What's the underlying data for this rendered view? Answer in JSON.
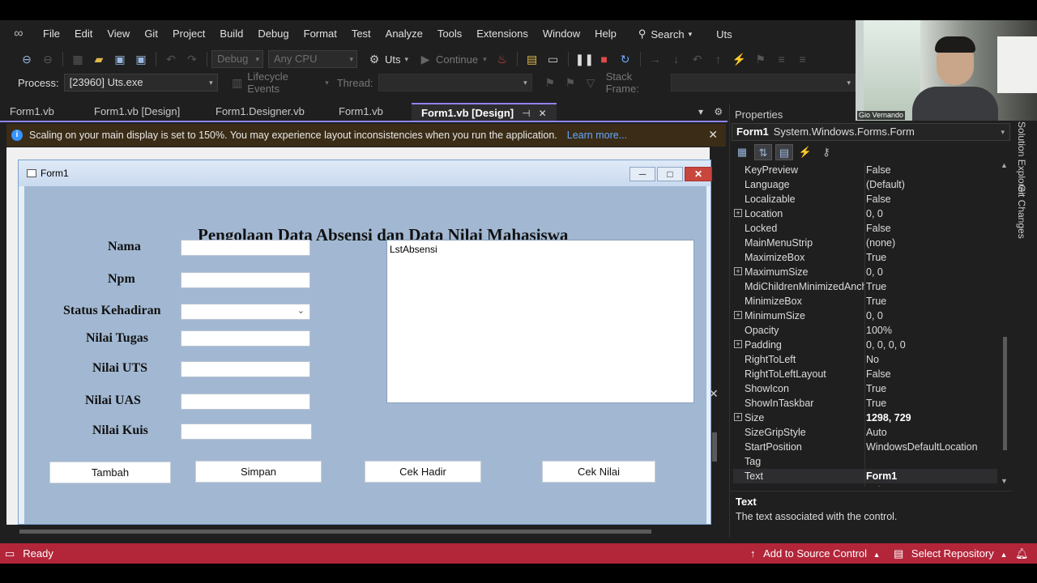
{
  "menu": {
    "items": [
      "File",
      "Edit",
      "View",
      "Git",
      "Project",
      "Build",
      "Debug",
      "Format",
      "Test",
      "Analyze",
      "Tools",
      "Extensions",
      "Window",
      "Help"
    ],
    "search_label": "Search",
    "solution_name": "Uts"
  },
  "toolbar": {
    "config": "Debug",
    "platform": "Any CPU",
    "startup_project": "Uts",
    "continue_label": "Continue",
    "process_label": "Process:",
    "process_value": "[23960] Uts.exe",
    "lifecycle_label": "Lifecycle Events",
    "thread_label": "Thread:",
    "stack_frame_label": "Stack Frame:"
  },
  "tabs": [
    "Form1.vb",
    "Form1.vb [Design]",
    "Form1.Designer.vb",
    "Form1.vb",
    "Form1.vb [Design]"
  ],
  "infobar": {
    "message": "Scaling on your main display is set to 150%. You may experience layout inconsistencies when you run the application.",
    "link": "Learn more..."
  },
  "form": {
    "title": "Form1",
    "heading": "Pengolaan Data Absensi dan Data Nilai Mahasiswa",
    "labels": {
      "nama": "Nama",
      "npm": "Npm",
      "status": "Status Kehadiran",
      "tugas": "Nilai Tugas",
      "uts": "Nilai UTS",
      "uas": "Nilai UAS",
      "kuis": "Nilai Kuis"
    },
    "listbox_text": "LstAbsensi",
    "buttons": {
      "tambah": "Tambah",
      "simpan": "Simpan",
      "cek_hadir": "Cek Hadir",
      "cek_nilai": "Cek Nilai"
    }
  },
  "properties": {
    "title": "Properties",
    "object_name": "Form1",
    "object_type": "System.Windows.Forms.Form",
    "rows": [
      {
        "name": "KeyPreview",
        "value": "False",
        "expand": false
      },
      {
        "name": "Language",
        "value": "(Default)",
        "expand": false
      },
      {
        "name": "Localizable",
        "value": "False",
        "expand": false
      },
      {
        "name": "Location",
        "value": "0, 0",
        "expand": true
      },
      {
        "name": "Locked",
        "value": "False",
        "expand": false
      },
      {
        "name": "MainMenuStrip",
        "value": "(none)",
        "expand": false
      },
      {
        "name": "MaximizeBox",
        "value": "True",
        "expand": false
      },
      {
        "name": "MaximumSize",
        "value": "0, 0",
        "expand": true
      },
      {
        "name": "MdiChildrenMinimizedAnchorBottom",
        "value": "True",
        "expand": false
      },
      {
        "name": "MinimizeBox",
        "value": "True",
        "expand": false
      },
      {
        "name": "MinimumSize",
        "value": "0, 0",
        "expand": true
      },
      {
        "name": "Opacity",
        "value": "100%",
        "expand": false
      },
      {
        "name": "Padding",
        "value": "0, 0, 0, 0",
        "expand": true
      },
      {
        "name": "RightToLeft",
        "value": "No",
        "expand": false
      },
      {
        "name": "RightToLeftLayout",
        "value": "False",
        "expand": false
      },
      {
        "name": "ShowIcon",
        "value": "True",
        "expand": false
      },
      {
        "name": "ShowInTaskbar",
        "value": "True",
        "expand": false
      },
      {
        "name": "Size",
        "value": "1298, 729",
        "expand": true,
        "bold": true
      },
      {
        "name": "SizeGripStyle",
        "value": "Auto",
        "expand": false
      },
      {
        "name": "StartPosition",
        "value": "WindowsDefaultLocation",
        "expand": false
      },
      {
        "name": "Tag",
        "value": "",
        "expand": false
      },
      {
        "name": "Text",
        "value": "Form1",
        "expand": false,
        "bold": true,
        "selected": true
      },
      {
        "name": "TopMost",
        "value": "False",
        "expand": false
      }
    ],
    "desc_title": "Text",
    "desc_body": "The text associated with the control."
  },
  "side_tabs": [
    "Solution Explorer",
    "Git Changes"
  ],
  "webcam_label": "Gio Vernando",
  "status": {
    "ready": "Ready",
    "source_control": "Add to Source Control",
    "repository": "Select Repository"
  }
}
